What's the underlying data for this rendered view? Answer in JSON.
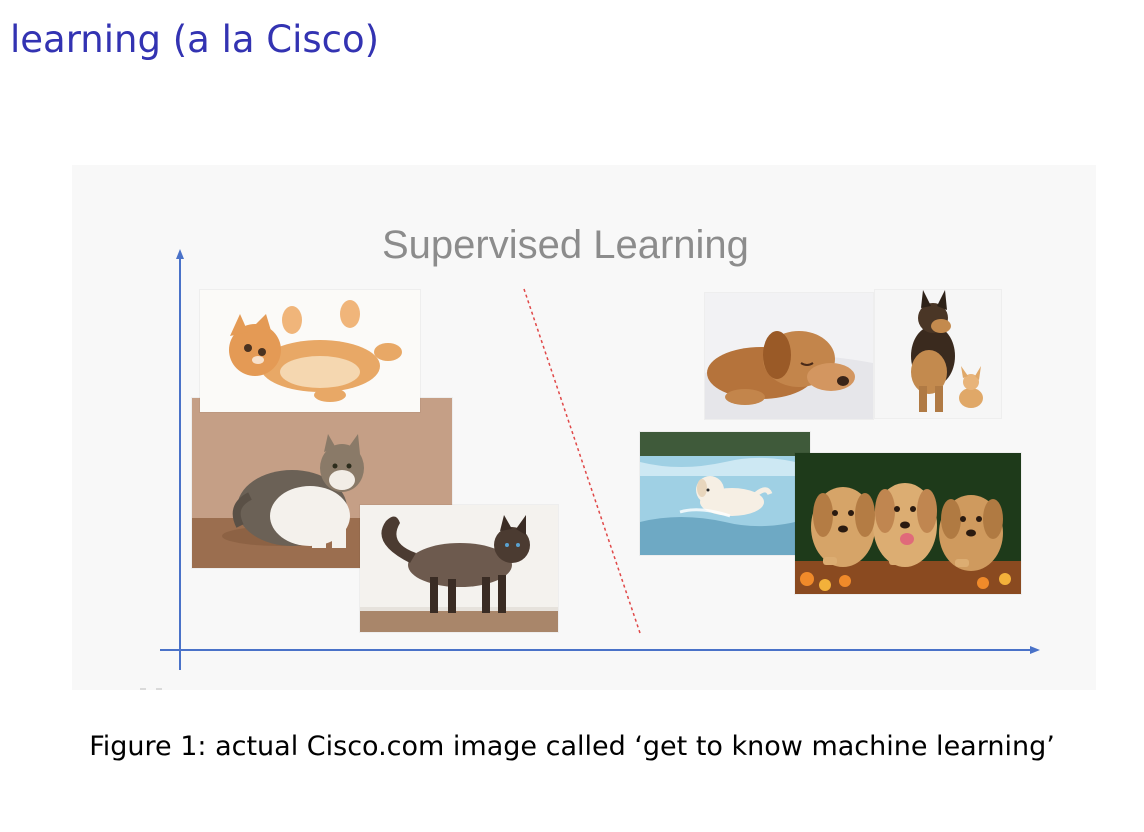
{
  "slide": {
    "title": "learning (a la Cisco)"
  },
  "figure": {
    "heading": "Supervised Learning",
    "images": {
      "left_group": [
        "kitten-photo",
        "tabby-cat-photo",
        "siamese-cat-photo"
      ],
      "right_group": [
        "sleeping-puppy-photo",
        "shepherd-and-chihuahua-photo",
        "puppy-running-in-water-photo",
        "three-golden-puppies-photo"
      ]
    },
    "colors": {
      "title": "#3333b2",
      "axis": "#4a72c8",
      "divider": "#e04848",
      "heading": "#8c8c8c"
    }
  },
  "caption": {
    "text": "Figure 1: actual Cisco.com image called ‘get to know machine learning’"
  }
}
